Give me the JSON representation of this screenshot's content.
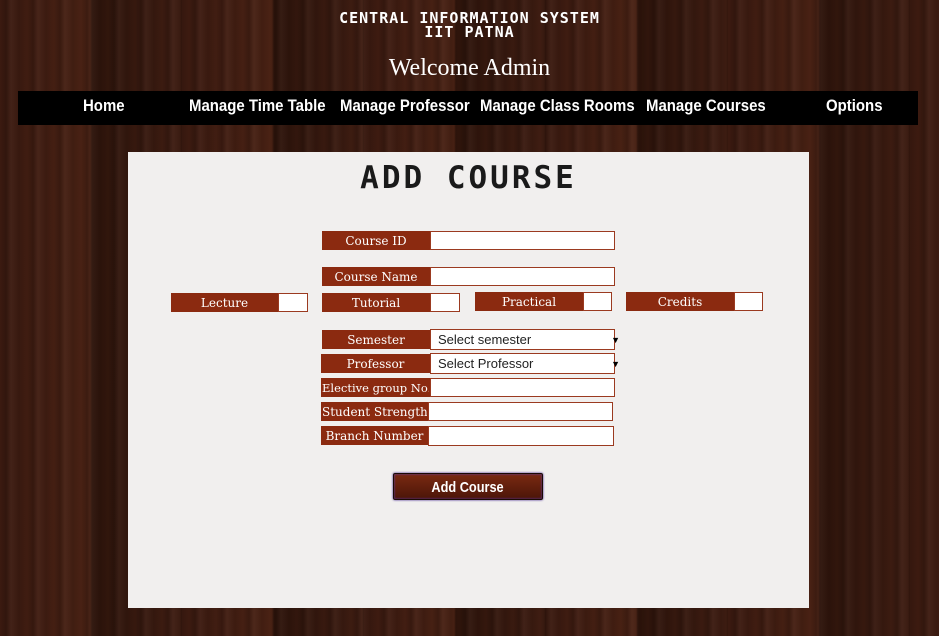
{
  "header": {
    "system_title": "CENTRAL INFORMATION SYSTEM",
    "institute": "IIT PATNA",
    "welcome": "Welcome Admin"
  },
  "nav": {
    "items": [
      {
        "label": "Home"
      },
      {
        "label": "Manage Time Table"
      },
      {
        "label": "Manage Professor"
      },
      {
        "label": "Manage Class Rooms"
      },
      {
        "label": "Manage Courses"
      },
      {
        "label": "Options"
      }
    ]
  },
  "form": {
    "title": "ADD COURSE",
    "course_id_label": "Course ID",
    "course_id_value": "",
    "course_name_label": "Course Name",
    "course_name_value": "",
    "lecture_label": "Lecture",
    "tutorial_label": "Tutorial",
    "practical_label": "Practical",
    "credits_label": "Credits",
    "semester_label": "Semester",
    "semester_selected": "Select semester",
    "professor_label": "Professor",
    "professor_selected": "Select Professor",
    "elective_label": "Elective group No.",
    "student_strength_label": "Student Strength",
    "branch_number_label": "Branch Number",
    "submit_label": "Add Course"
  },
  "colors": {
    "label_bg": "#8b2a10",
    "navbar_bg": "#000000",
    "panel_bg": "#f1efee"
  }
}
